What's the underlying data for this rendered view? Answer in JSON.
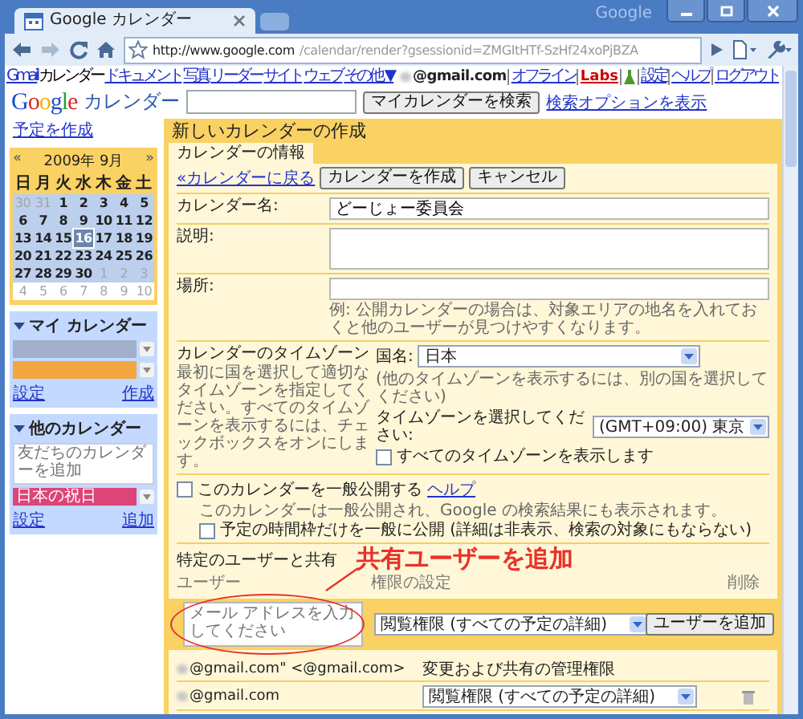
{
  "browser": {
    "window_title": "Google",
    "tabs": [
      {
        "title": "Google カレンダー",
        "selected": true
      }
    ],
    "url_host": "http://www.google.com",
    "url_path": "/calendar/render?gsessionid=ZMGItHTf-SzHf24xoPjBZA"
  },
  "google_bar": {
    "links": [
      {
        "label": "Gmail",
        "selected": false
      },
      {
        "label": "カレンダー",
        "selected": true
      },
      {
        "label": "ドキュメント",
        "selected": false
      },
      {
        "label": "写真",
        "selected": false
      },
      {
        "label": "リーダー",
        "selected": false
      },
      {
        "label": "サイト",
        "selected": false
      },
      {
        "label": "ウェブ",
        "selected": false
      },
      {
        "label": "その他 ▼",
        "selected": false
      }
    ],
    "account": "@gmail.com",
    "right_links": [
      {
        "kind": "link",
        "label": "オフライン"
      },
      {
        "kind": "labs",
        "label": "Labs"
      },
      {
        "kind": "icon"
      },
      {
        "kind": "link",
        "label": "設定"
      },
      {
        "kind": "link",
        "label": "ヘルプ"
      },
      {
        "kind": "link",
        "label": "ログアウト"
      }
    ]
  },
  "search_bar": {
    "logo": "Google",
    "product": "カレンダー",
    "button": "マイカレンダーを検索",
    "options_link": "検索オプションを表示"
  },
  "sidebar": {
    "create_link": "予定を作成",
    "mini_calendar": {
      "prev": "«",
      "month": "2009年 9月",
      "next": "»",
      "weekdays": [
        "日",
        "月",
        "火",
        "水",
        "木",
        "金",
        "土"
      ],
      "weeks": [
        {
          "in_view": true,
          "days": [
            {
              "day": "30",
              "other_month": true,
              "today": false
            },
            {
              "day": "31",
              "other_month": true,
              "today": false
            },
            {
              "day": "1",
              "other_month": false,
              "today": false
            },
            {
              "day": "2",
              "other_month": false,
              "today": false
            },
            {
              "day": "3",
              "other_month": false,
              "today": false
            },
            {
              "day": "4",
              "other_month": false,
              "today": false
            },
            {
              "day": "5",
              "other_month": false,
              "today": false
            }
          ]
        },
        {
          "in_view": true,
          "days": [
            {
              "day": "6",
              "other_month": false,
              "today": false
            },
            {
              "day": "7",
              "other_month": false,
              "today": false
            },
            {
              "day": "8",
              "other_month": false,
              "today": false
            },
            {
              "day": "9",
              "other_month": false,
              "today": false
            },
            {
              "day": "10",
              "other_month": false,
              "today": false
            },
            {
              "day": "11",
              "other_month": false,
              "today": false
            },
            {
              "day": "12",
              "other_month": false,
              "today": false
            }
          ]
        },
        {
          "in_view": true,
          "days": [
            {
              "day": "13",
              "other_month": false,
              "today": false
            },
            {
              "day": "14",
              "other_month": false,
              "today": false
            },
            {
              "day": "15",
              "other_month": false,
              "today": false
            },
            {
              "day": "16",
              "other_month": false,
              "today": true
            },
            {
              "day": "17",
              "other_month": false,
              "today": false
            },
            {
              "day": "18",
              "other_month": false,
              "today": false
            },
            {
              "day": "19",
              "other_month": false,
              "today": false
            }
          ]
        },
        {
          "in_view": true,
          "days": [
            {
              "day": "20",
              "other_month": false,
              "today": false
            },
            {
              "day": "21",
              "other_month": false,
              "today": false
            },
            {
              "day": "22",
              "other_month": false,
              "today": false
            },
            {
              "day": "23",
              "other_month": false,
              "today": false
            },
            {
              "day": "24",
              "other_month": false,
              "today": false
            },
            {
              "day": "25",
              "other_month": false,
              "today": false
            },
            {
              "day": "26",
              "other_month": false,
              "today": false
            }
          ]
        },
        {
          "in_view": true,
          "days": [
            {
              "day": "27",
              "other_month": false,
              "today": false
            },
            {
              "day": "28",
              "other_month": false,
              "today": false
            },
            {
              "day": "29",
              "other_month": false,
              "today": false
            },
            {
              "day": "30",
              "other_month": false,
              "today": false
            },
            {
              "day": "1",
              "other_month": true,
              "today": false
            },
            {
              "day": "2",
              "other_month": true,
              "today": false
            },
            {
              "day": "3",
              "other_month": true,
              "today": false
            }
          ]
        },
        {
          "in_view": false,
          "days": [
            {
              "day": "4",
              "other_month": true,
              "today": false
            },
            {
              "day": "5",
              "other_month": true,
              "today": false
            },
            {
              "day": "6",
              "other_month": true,
              "today": false
            },
            {
              "day": "7",
              "other_month": true,
              "today": false
            },
            {
              "day": "8",
              "other_month": true,
              "today": false
            },
            {
              "day": "9",
              "other_month": true,
              "today": false
            },
            {
              "day": "10",
              "other_month": true,
              "today": false
            }
          ]
        }
      ]
    },
    "my_calendars": {
      "title": "マイ カレンダー",
      "expanded": true,
      "items": [
        {
          "color": "#a2b0c9"
        },
        {
          "color": "#f2a640"
        }
      ],
      "links": [
        "設定",
        "作成"
      ]
    },
    "other_calendars": {
      "title": "他のカレンダー",
      "expanded": true,
      "placeholder": "友だちのカレンダーを追加",
      "items": [
        {
          "name": "日本の祝日",
          "color": "#dd4477"
        }
      ],
      "links": [
        "設定",
        "追加"
      ]
    }
  },
  "main": {
    "title": "新しいカレンダーの作成",
    "tabs": [
      {
        "label": "カレンダーの情報",
        "selected": true
      }
    ],
    "back_link": "«カレンダーに戻る",
    "buttons": [
      "カレンダーを作成",
      "キャンセル"
    ],
    "name": {
      "label": "カレンダー名:",
      "value": "どーじょー委員会"
    },
    "description": {
      "label": "説明:"
    },
    "location": {
      "label": "場所:",
      "hint": "例: 公開カレンダーの場合は、対象エリアの地名を入れておくと他のユーザーが見つけやすくなります。"
    },
    "timezone": {
      "title": "カレンダーのタイムゾーン",
      "hint": "最初に国を選択して適切なタイムゾーンを指定してください。すべてのタイムゾーンを表示するには、チェックボックスをオンにします。",
      "country_label": "国名:",
      "country": "日本",
      "country_hint": "(他のタイムゾーンを表示するには、別の国を選択してください)",
      "zone_label": "タイムゾーンを選択してください:",
      "zone": "(GMT+09:00) 東京",
      "show_all": {
        "label": "すべてのタイムゾーンを表示します",
        "checked": false
      }
    },
    "public": {
      "checked": false,
      "label": "このカレンダーを一般公開する",
      "help_link": "ヘルプ",
      "hint": "このカレンダーは一般公開され、Google の検索結果にも表示されます。",
      "sub_option": {
        "label": "予定の時間枠だけを一般に公開 (詳細は非表示、検索の対象にもならない)",
        "checked": false
      }
    },
    "sharing": {
      "title": "特定のユーザーと共有",
      "columns": [
        "ユーザー",
        "権限の設定",
        "削除"
      ],
      "new_row": {
        "placeholder": "メール アドレスを入力してください",
        "permission": "閲覧権限 (すべての予定の詳細)",
        "button": "ユーザーを追加"
      },
      "rows": [
        {
          "kind": "owner",
          "user": "@gmail.com\" <@gmail.com>",
          "permission": "変更および共有の管理権限"
        },
        {
          "kind": "shared",
          "user": "@gmail.com",
          "permission": "閲覧権限 (すべての予定の詳細)"
        }
      ]
    }
  },
  "annotation": {
    "text": "共有ユーザーを追加"
  }
}
